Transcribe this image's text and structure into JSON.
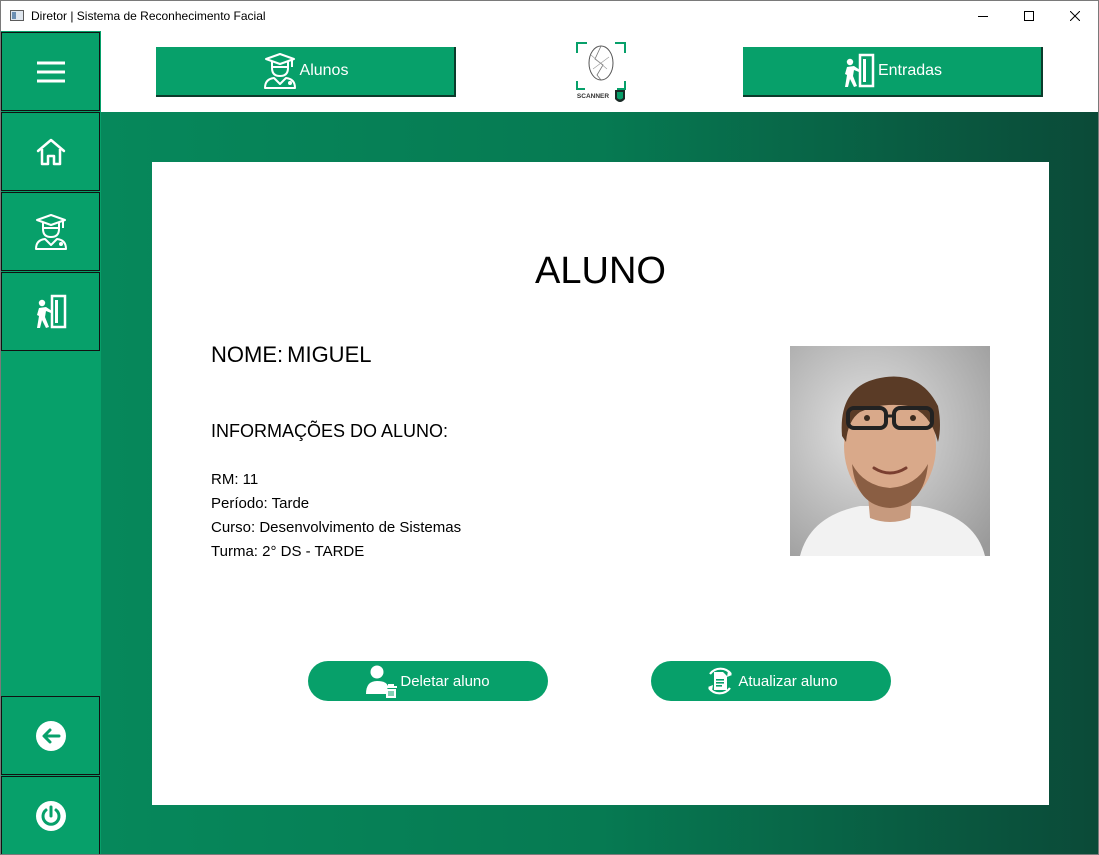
{
  "window": {
    "title": "Diretor | Sistema de Reconhecimento Facial"
  },
  "topbar": {
    "alunos_label": "Alunos",
    "entradas_label": "Entradas",
    "logo_text": "SCANNER"
  },
  "sidebar": {
    "items": [
      {
        "icon": "menu-icon"
      },
      {
        "icon": "home-icon"
      },
      {
        "icon": "student-icon"
      },
      {
        "icon": "entry-door-icon"
      },
      {
        "icon": "back-arrow-icon"
      },
      {
        "icon": "power-icon"
      }
    ]
  },
  "student": {
    "page_title": "ALUNO",
    "nome_label": "NOME:",
    "nome_value": "MIGUEL",
    "info_heading": "INFORMAÇÕES DO ALUNO:",
    "rm": "RM: 11",
    "periodo": "Período: Tarde",
    "curso": "Curso: Desenvolvimento de Sistemas",
    "turma": "Turma: 2° DS - TARDE"
  },
  "actions": {
    "delete_label": "Deletar aluno",
    "update_label": "Atualizar aluno"
  },
  "colors": {
    "accent": "#07a06a",
    "dark": "#0b4a38"
  }
}
